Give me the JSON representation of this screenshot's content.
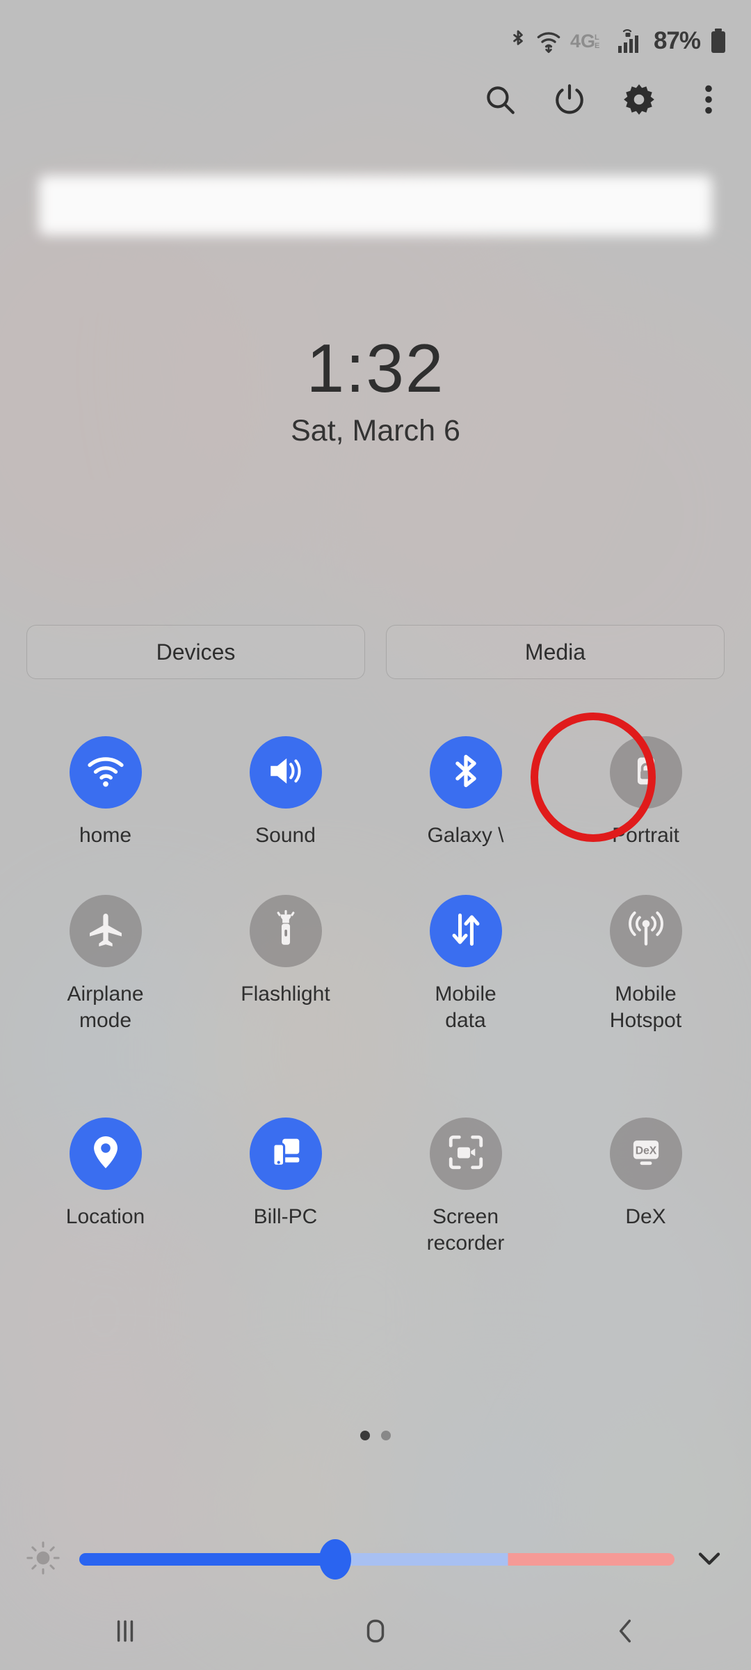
{
  "status_bar": {
    "battery_percent": "87%",
    "icons": [
      "bluetooth-icon",
      "wifi-icon",
      "4g-lte-icon",
      "signal-bars-icon",
      "battery-icon"
    ],
    "network_label": "4G",
    "network_sub_label": "LTE"
  },
  "toolbar": {
    "search_label": "search-icon",
    "power_label": "power-icon",
    "settings_label": "gear-icon",
    "more_label": "more-vertical-icon"
  },
  "notification": {
    "blurred": "blurred-notification-card"
  },
  "clock": {
    "time": "1:32",
    "date": "Sat, March 6"
  },
  "shortcuts": {
    "devices_label": "Devices",
    "media_label": "Media"
  },
  "tiles": [
    [
      {
        "label": "home",
        "icon": "wifi-icon",
        "state": "on"
      },
      {
        "label": "Sound",
        "icon": "sound-icon",
        "state": "on"
      },
      {
        "label": "Galaxy \\",
        "icon": "bluetooth-icon",
        "state": "on"
      },
      {
        "label": "Portrait",
        "icon": "rotation-lock-icon",
        "state": "off",
        "highlighted": true
      }
    ],
    [
      {
        "label": "Airplane\nmode",
        "icon": "airplane-icon",
        "state": "off"
      },
      {
        "label": "Flashlight",
        "icon": "flashlight-icon",
        "state": "off"
      },
      {
        "label": "Mobile\ndata",
        "icon": "data-arrows-icon",
        "state": "on"
      },
      {
        "label": "Mobile\nHotspot",
        "icon": "hotspot-icon",
        "state": "off"
      }
    ],
    [
      {
        "label": "Location",
        "icon": "location-pin-icon",
        "state": "on"
      },
      {
        "label": "Bill-PC",
        "icon": "smart-view-icon",
        "state": "on"
      },
      {
        "label": "Screen\nrecorder",
        "icon": "screen-recorder-icon",
        "state": "off"
      },
      {
        "label": "DeX",
        "icon": "dex-icon",
        "state": "off"
      }
    ]
  ],
  "pager": {
    "total_pages": 2,
    "current_page": 1
  },
  "brightness": {
    "icon": "brightness-sun-icon",
    "value_percent": 43,
    "expand_icon": "chevron-down-icon"
  },
  "nav_bar": {
    "recents_label": "recents-icon",
    "home_label": "home-icon",
    "back_label": "back-icon"
  },
  "colors": {
    "accent_blue": "#3a6ef0",
    "tile_off": "#807c7c",
    "highlight_red": "#e01b1b",
    "background_gray": "#bfbfbf"
  }
}
